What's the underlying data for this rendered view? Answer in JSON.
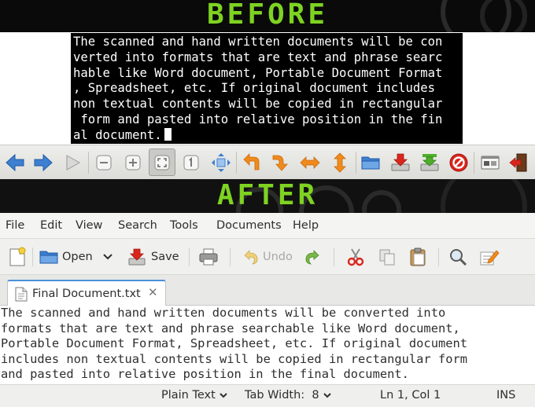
{
  "before_banner": {
    "label": "BEFORE"
  },
  "after_banner": {
    "label": "AFTER"
  },
  "scanned_text": {
    "lines": [
      "The scanned and hand written documents will be con",
      "verted into formats that are text and phrase searc",
      "hable like Word document, Portable Document Format",
      ", Spreadsheet, etc. If original document includes ",
      "non textual contents will be copied in rectangular",
      " form and pasted into relative position in the fin",
      "al document."
    ]
  },
  "ocr_toolbar": {
    "icons": [
      "arrow-left-icon",
      "arrow-right-icon",
      "play-icon",
      "zoom-out-icon",
      "zoom-in-icon",
      "zoom-fit-icon",
      "zoom-original-icon",
      "fit-window-icon",
      "rotate-left-icon",
      "rotate-right-icon",
      "flip-horizontal-icon",
      "flip-vertical-icon",
      "folder-open-icon",
      "download-icon",
      "export-icon",
      "stop-icon",
      "window-icon",
      "exit-icon"
    ]
  },
  "editor": {
    "menu": [
      "File",
      "Edit",
      "View",
      "Search",
      "Tools",
      "Documents",
      "Help"
    ],
    "toolbar": {
      "open_label": "Open",
      "save_label": "Save",
      "undo_label": "Undo"
    },
    "tab": {
      "title": "Final Document.txt",
      "close_symbol": "✕"
    },
    "document_lines": [
      "The scanned and hand written documents will be converted into",
      "formats that are text and phrase searchable like Word document,",
      "Portable Document Format, Spreadsheet, etc. If original document",
      "includes non textual contents will be copied in rectangular form",
      "and pasted into relative position in the final document."
    ],
    "status": {
      "syntax": "Plain Text",
      "tab_width": "Tab Width:  8",
      "position": "Ln 1, Col 1",
      "mode": "INS"
    }
  },
  "colors": {
    "banner_text": "#7ed321",
    "tab_accent": "#4a90d9",
    "toolbar_blue": "#3d7fd0",
    "toolbar_orange": "#f08a1c",
    "toolbar_red": "#d9261c",
    "toolbar_green": "#4caf28"
  }
}
